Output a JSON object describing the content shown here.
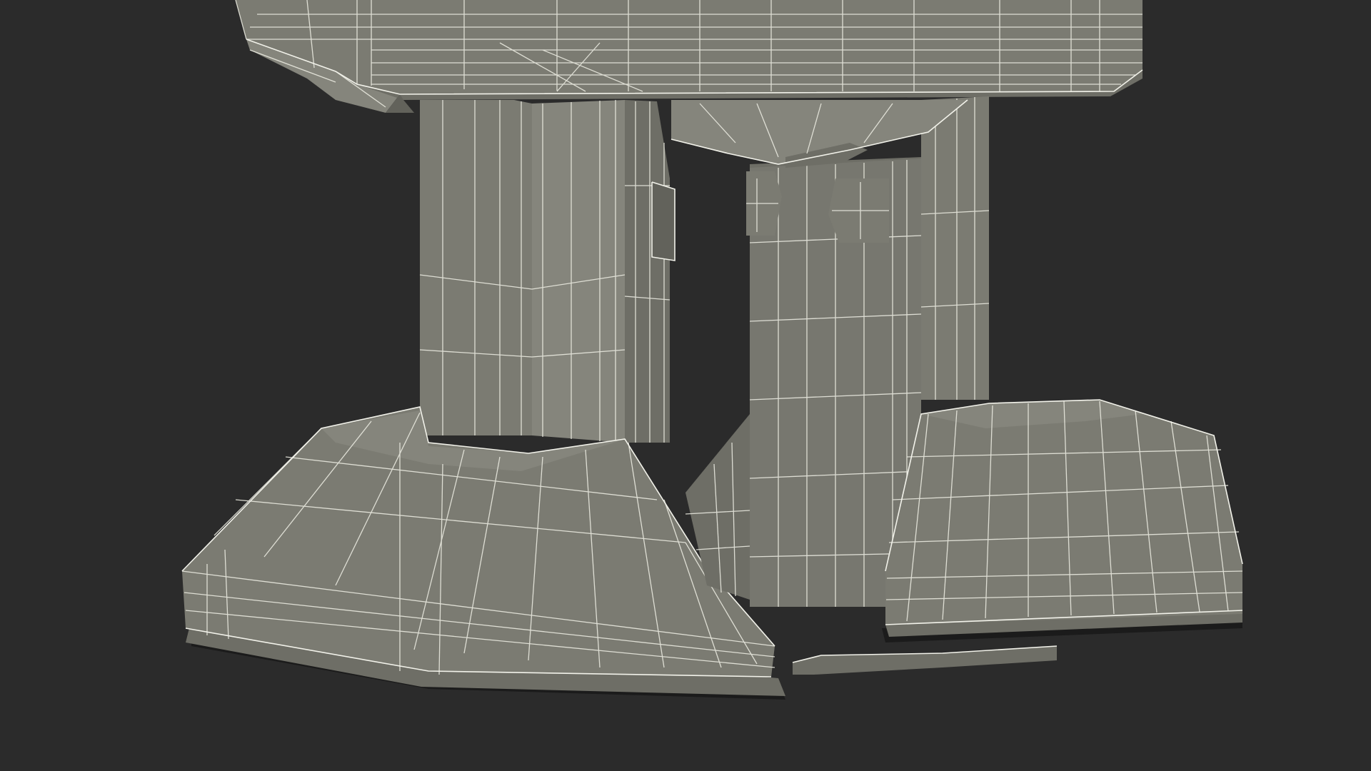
{
  "scene": {
    "subject": "wireframe-3d-model",
    "colors": {
      "background": "#2b2b2b",
      "surface": "#7b7b72",
      "wire": "#e9e9df"
    }
  }
}
